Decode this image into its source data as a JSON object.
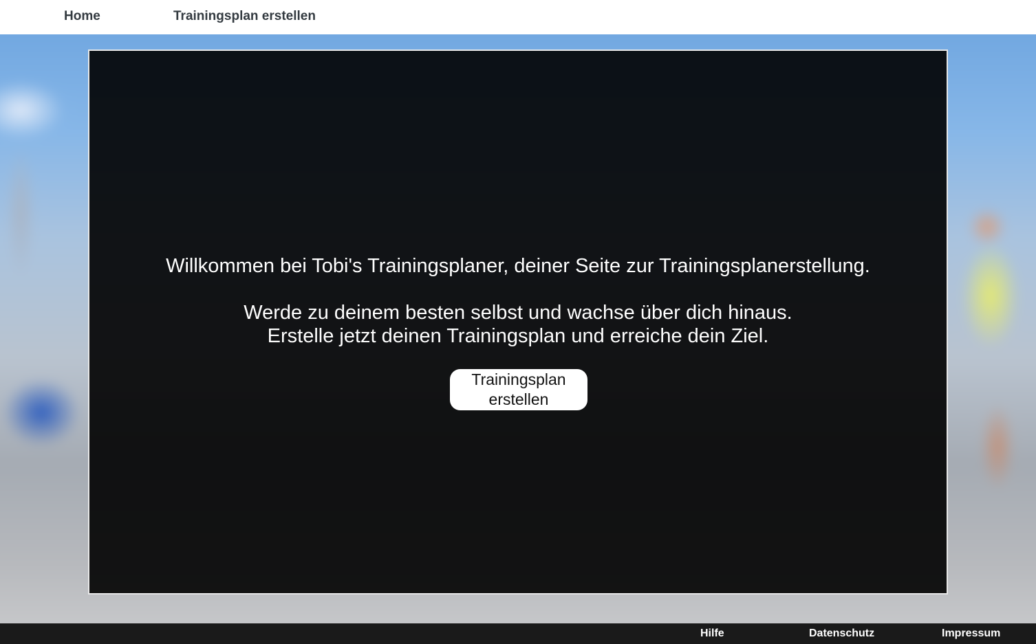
{
  "nav": {
    "home": "Home",
    "trainingsplan": "Trainingsplan erstellen"
  },
  "hero": {
    "welcome": "Willkommen bei Tobi's Trainingsplaner, deiner Seite zur Trainingsplanerstellung.",
    "line1": "Werde zu deinem besten selbst und wachse über dich hinaus.",
    "line2": "Erstelle jetzt deinen Trainingsplan und erreiche dein Ziel.",
    "button": "Trainingsplan erstellen"
  },
  "footer": {
    "hilfe": "Hilfe",
    "datenschutz": "Datenschutz",
    "impressum": "Impressum"
  },
  "colors": {
    "nav_text": "#333a40",
    "footer_bg": "#1a1a1a",
    "overlay": "#000000"
  }
}
